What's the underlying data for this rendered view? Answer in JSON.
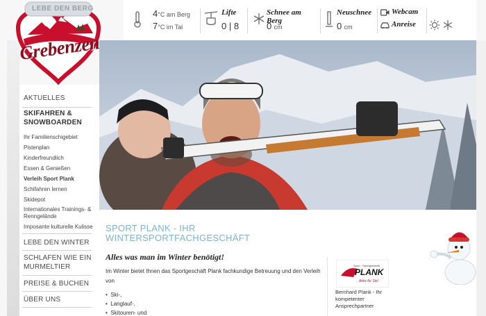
{
  "logo": {
    "tagline": "LEBE DEN BERG",
    "brand": "Grebenzen"
  },
  "weather": {
    "temp_mountain_value": "4",
    "temp_mountain_unit": "°C am Berg",
    "temp_valley_value": "7",
    "temp_valley_unit": "°C im Tal",
    "lifts_label": "Lifte",
    "lifts_value": "0 | 8",
    "snow_mountain_label": "Schnee am Berg",
    "snow_mountain_value": "0",
    "snow_mountain_unit": "cm",
    "new_snow_label": "Neuschnee",
    "new_snow_value": "0",
    "new_snow_unit": "cm",
    "webcam_label": "Webcam",
    "directions_label": "Anreise"
  },
  "nav": {
    "aktuelles": "AKTUELLES",
    "skifahren_line1": "SKIFAHREN &",
    "skifahren_line2": "SNOWBOARDEN",
    "sub": [
      "Ihr Familienschigebiet",
      "Pistenplan",
      "Kinderfreundlich",
      "Essen & Genießen",
      "Verleih Sport Plank",
      "Schifahren lernen",
      "Skidepot",
      "Internationales Trainings- &",
      "Renngelände",
      "Imposante kulturelle Kulisse"
    ],
    "lebe": "LEBE DEN WINTER",
    "schlafen_line1": "SCHLAFEN WIE EIN",
    "schlafen_line2": "MURMELTIER",
    "preise": "PREISE & BUCHEN",
    "ueber": "ÜBER UNS"
  },
  "content": {
    "heading_line1": "SPORT PLANK - IHR",
    "heading_line2": "WINTERSPORTFACHGESCHÄFT",
    "subheading": "Alles was man im Winter benötigt!",
    "paragraph": "Im Winter bietet Ihnen das Sportgeschäft Plank fachkundige Betreuung und den Verleih von",
    "list": [
      "Ski-,",
      "Langlauf-,",
      "Skitouren- und"
    ]
  },
  "contact_card": {
    "logo_text": "PLANK",
    "logo_tagline": "Sport · Sportgeschäft",
    "logo_slogan": "Aktiv für Sie!",
    "text": "Bernhard Plank - Ihr kompetenter Ansprechpartner"
  },
  "colors": {
    "heading_blue": "#7fb3d0",
    "logo_red": "#c8102e",
    "hero_sky": "#b9c6d6"
  },
  "icons": [
    "thermometer-icon",
    "ski-lift-icon",
    "snowflake-icon",
    "new-snow-gauge-icon",
    "webcam-icon",
    "car-icon",
    "sun-icon",
    "snowflake-small-icon"
  ]
}
